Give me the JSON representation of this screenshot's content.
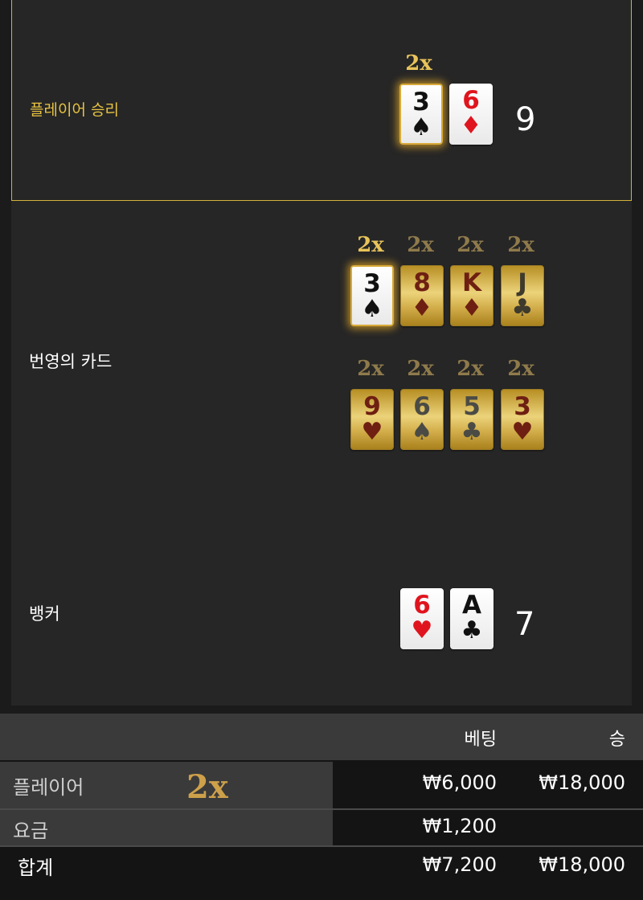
{
  "player": {
    "label": "플레이어 승리",
    "multiplier": "2x",
    "cards": [
      {
        "rank": "3",
        "suit": "♠",
        "color": "black"
      },
      {
        "rank": "6",
        "suit": "♦",
        "color": "red"
      }
    ],
    "score": "9"
  },
  "lucky": {
    "label": "번영의 카드",
    "multipliers": [
      "2x",
      "2x",
      "2x",
      "2x",
      "2x",
      "2x",
      "2x",
      "2x"
    ],
    "cards": [
      {
        "rank": "3",
        "suit": "♠"
      },
      {
        "rank": "8",
        "suit": "♦"
      },
      {
        "rank": "K",
        "suit": "♦"
      },
      {
        "rank": "J",
        "suit": "♣"
      },
      {
        "rank": "9",
        "suit": "♥"
      },
      {
        "rank": "6",
        "suit": "♠"
      },
      {
        "rank": "5",
        "suit": "♣"
      },
      {
        "rank": "3",
        "suit": "♥"
      }
    ]
  },
  "banker": {
    "label": "뱅커",
    "cards": [
      {
        "rank": "6",
        "suit": "♥",
        "color": "red"
      },
      {
        "rank": "A",
        "suit": "♣",
        "color": "black"
      }
    ],
    "score": "7"
  },
  "summary": {
    "col_bet": "베팅",
    "col_win": "승",
    "rows": [
      {
        "label": "플레이어",
        "multiplier": "2x",
        "bet": "₩6,000",
        "win": "₩18,000"
      },
      {
        "label": "요금",
        "bet": "₩1,200",
        "win": ""
      },
      {
        "label": "합계",
        "bet": "₩7,200",
        "win": "₩18,000"
      }
    ]
  },
  "colors": {
    "accent_gold": "#e7c341",
    "panel": "#262626",
    "background": "#1b1b1b"
  }
}
